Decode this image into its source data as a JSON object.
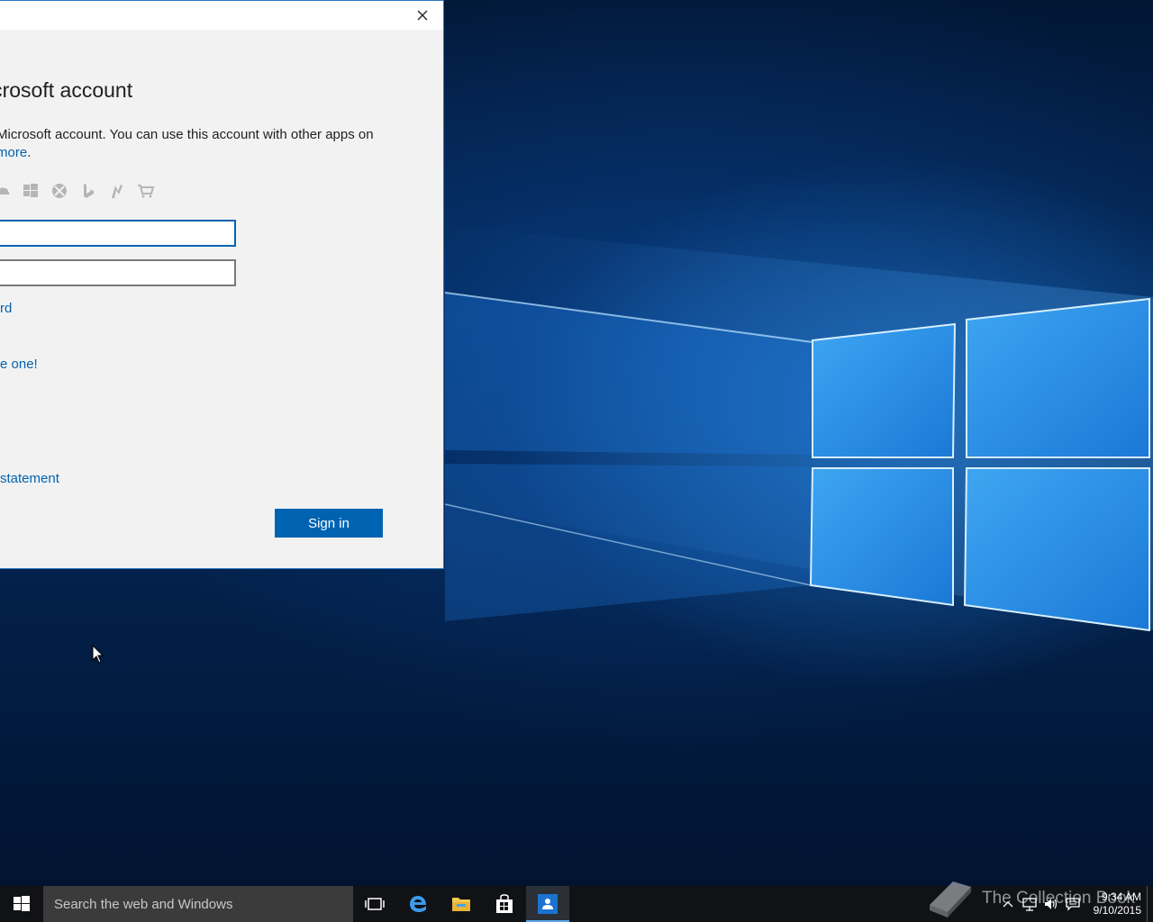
{
  "dialog": {
    "close_label": "×",
    "heading": "icrosoft account",
    "description_line1": "Microsoft account. You can use this account with other apps on",
    "learn_more_link": "more",
    "learn_more_suffix": ".",
    "service_icons": [
      "onedrive-icon",
      "windows-icon",
      "xbox-icon",
      "bing-icon",
      "msn-icon",
      "store-icon"
    ],
    "email_value": "",
    "password_value": "",
    "forgot_password_link": "rd",
    "create_account_link": "e one!",
    "privacy_link": "statement",
    "signin_label": "Sign in"
  },
  "taskbar": {
    "search_placeholder": "Search the web and Windows",
    "pinned": [
      "task-view-icon",
      "edge-icon",
      "file-explorer-icon",
      "store-icon",
      "people-app-icon"
    ],
    "clock_time": "9:34 AM",
    "clock_date": "9/10/2015"
  },
  "watermark": "The Collection Book",
  "colors": {
    "accent": "#0063b1",
    "dialog_bg": "#f2f2f2",
    "taskbar_bg": "#101216"
  }
}
